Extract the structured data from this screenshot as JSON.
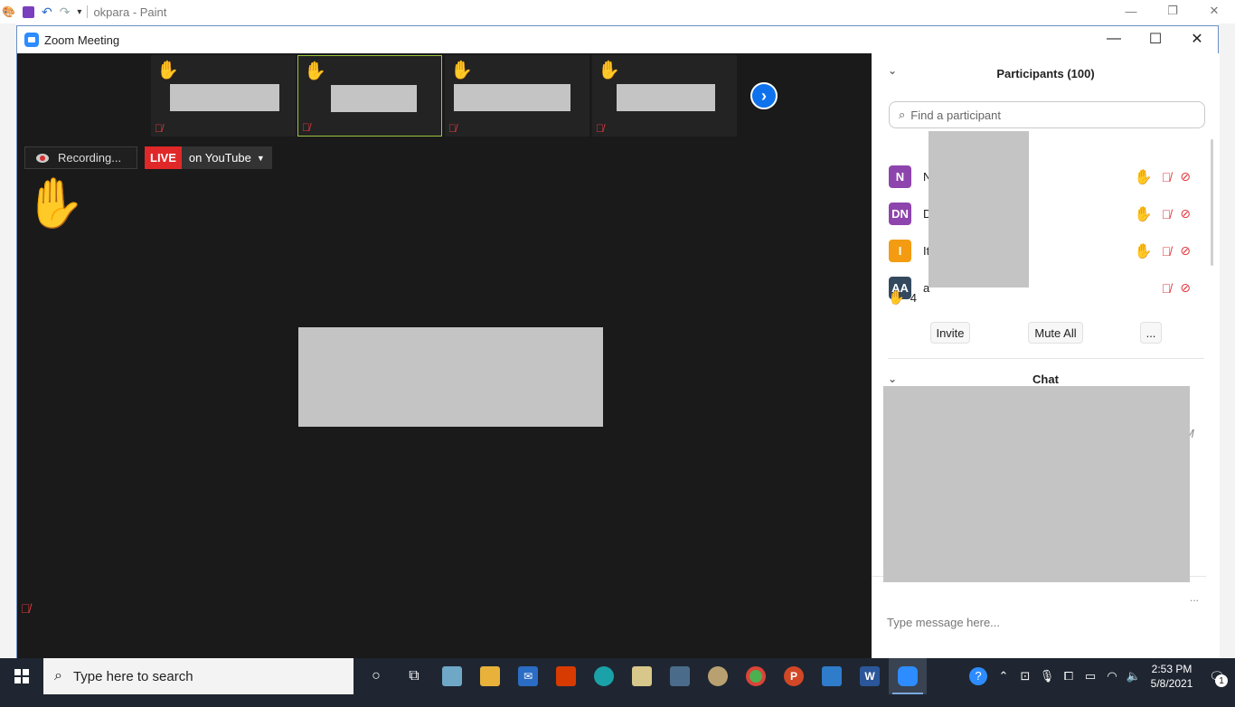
{
  "paint": {
    "title": "okpara - Paint",
    "minimize": "—",
    "restore": "❐",
    "close": "✕"
  },
  "zoom": {
    "title": "Zoom Meeting",
    "minimize": "—",
    "maximize": "☐",
    "close": "✕"
  },
  "video": {
    "recording_label": "Recording...",
    "live_tag": "LIVE",
    "live_platform": "on YouTube",
    "next_arrow": "›"
  },
  "participants": {
    "header": "Participants (100)",
    "search_placeholder": "Find a participant",
    "rows": [
      {
        "initials": "N",
        "name": "N",
        "color": "#8e44ad",
        "hand": true
      },
      {
        "initials": "DN",
        "name": "D",
        "color": "#8e44ad",
        "hand": true
      },
      {
        "initials": "I",
        "name": "It",
        "color": "#f39c12",
        "hand": true
      },
      {
        "initials": "AA",
        "name": "a",
        "color": "#34495e",
        "hand": false
      }
    ],
    "raised_hands_count": "4",
    "invite_label": "Invite",
    "mute_all_label": "Mute All",
    "more_label": "..."
  },
  "chat": {
    "header": "Chat",
    "time_fragment": "M",
    "more": "...",
    "input_placeholder": "Type message here..."
  },
  "taskbar": {
    "search_placeholder": "Type here to search",
    "time": "2:53 PM",
    "date": "5/8/2021",
    "notification_count": "1"
  }
}
